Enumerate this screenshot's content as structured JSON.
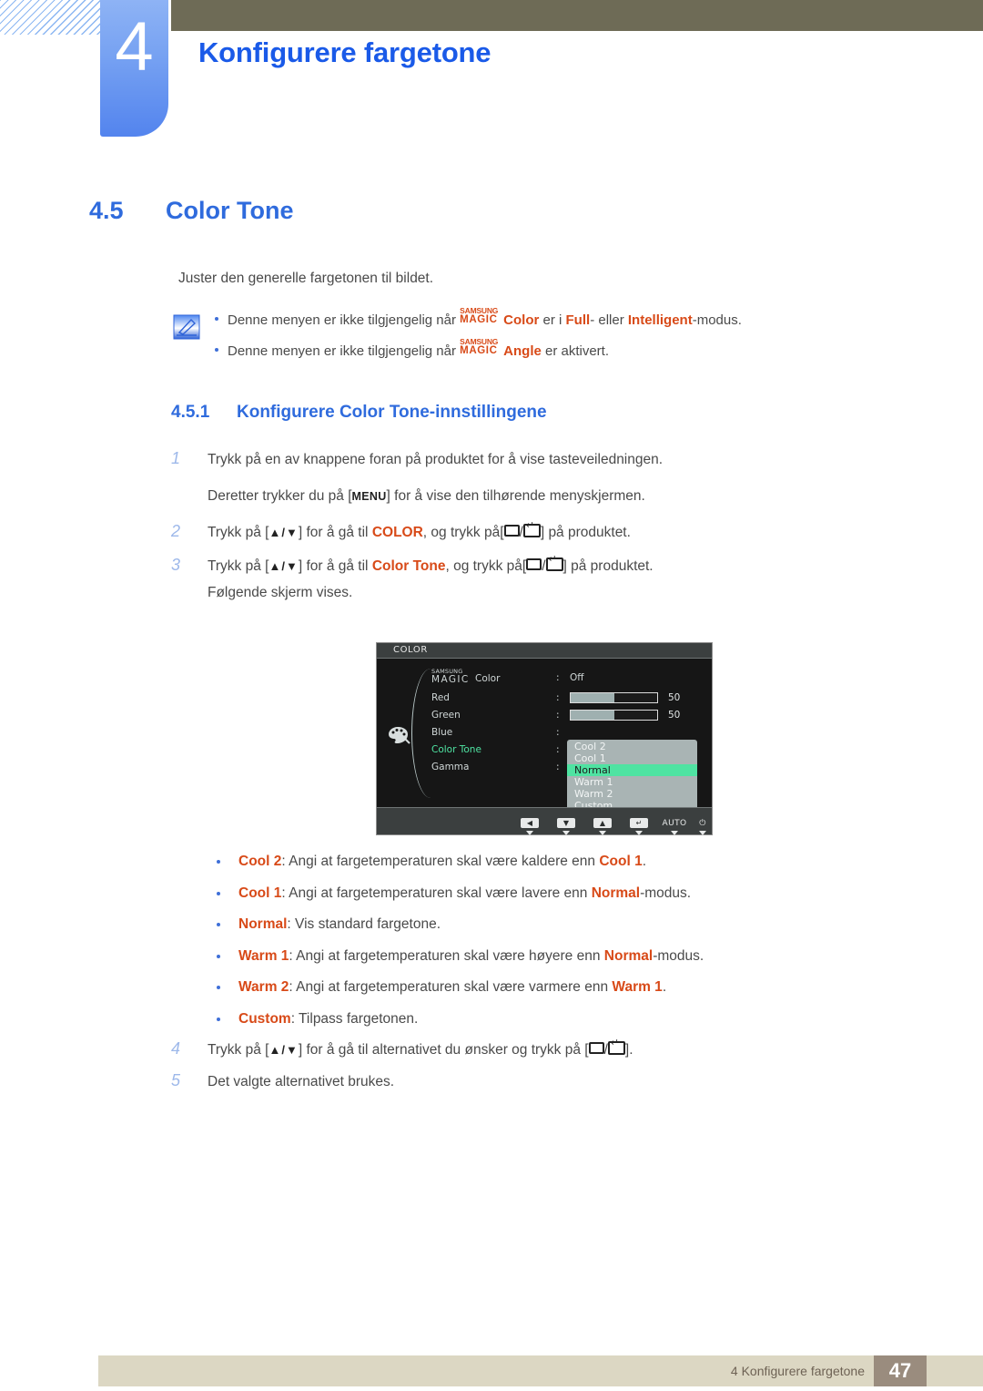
{
  "header": {
    "chapter_number": "4",
    "chapter_title": "Konfigurere fargetone"
  },
  "section": {
    "number": "4.5",
    "title": "Color Tone"
  },
  "intro": "Juster den generelle fargetonen til bildet.",
  "notes": {
    "icon": "note-pencil-icon",
    "items": [
      {
        "pre": "Denne menyen er ikke tilgjengelig når ",
        "magic_top": "SAMSUNG",
        "magic_bottom": "MAGIC",
        "magic_word": "Color",
        "mid": " er i ",
        "em1": "Full",
        "mid2": "- eller ",
        "em2": "Intelligent",
        "post": "-modus."
      },
      {
        "pre": "Denne menyen er ikke tilgjengelig når ",
        "magic_top": "SAMSUNG",
        "magic_bottom": "MAGIC",
        "magic_word": "Angle",
        "mid": " er aktivert.",
        "em1": "",
        "mid2": "",
        "em2": "",
        "post": ""
      }
    ]
  },
  "subsection": {
    "number": "4.5.1",
    "title": "Konfigurere Color Tone-innstillingene"
  },
  "steps": {
    "s1_num": "1",
    "s1_text": "Trykk på en av knappene foran på produktet for å vise tasteveiledningen.",
    "s1_sub_pre": "Deretter trykker du på [",
    "s1_sub_key": "MENU",
    "s1_sub_post": "] for å vise den tilhørende menyskjermen.",
    "s2_num": "2",
    "s2_a": "Trykk på [",
    "s2_arrows": "▲/▼",
    "s2_b": "] for å gå til ",
    "s2_target": "COLOR",
    "s2_c": ", og trykk på[",
    "s2_d": "/",
    "s2_e": "] på produktet.",
    "s3_num": "3",
    "s3_a": "Trykk på [",
    "s3_arrows": "▲/▼",
    "s3_b": "] for å gå til ",
    "s3_target": "Color Tone",
    "s3_c": ", og trykk på[",
    "s3_d": "/",
    "s3_e": "] på produktet.",
    "s3_sub": "Følgende skjerm vises.",
    "s4_num": "4",
    "s4_a": "Trykk på [",
    "s4_arrows": "▲/▼",
    "s4_b": "] for å gå til alternativet du ønsker og trykk på [",
    "s4_c": "/",
    "s4_d": "].",
    "s5_num": "5",
    "s5_text": "Det valgte alternativet brukes."
  },
  "osd": {
    "title": "COLOR",
    "icon": "palette-icon",
    "magic_top": "SAMSUNG",
    "magic_bottom": "MAGIC",
    "magic_word": "Color",
    "rows": [
      {
        "label": "Red",
        "colon": ":",
        "value": "50",
        "fill_percent": 50
      },
      {
        "label": "Green",
        "colon": ":",
        "value": "50",
        "fill_percent": 50
      },
      {
        "label": "Blue",
        "colon": ":",
        "value": ""
      },
      {
        "label": "Color Tone",
        "colon": ":",
        "value": ""
      },
      {
        "label": "Gamma",
        "colon": ":",
        "value": ""
      }
    ],
    "magic_value": "Off",
    "magic_colon": ":",
    "selected_label": "Color Tone",
    "dropdown": [
      {
        "label": "Cool 2",
        "selected": false
      },
      {
        "label": "Cool 1",
        "selected": false
      },
      {
        "label": "Normal",
        "selected": true
      },
      {
        "label": "Warm 1",
        "selected": false
      },
      {
        "label": "Warm 2",
        "selected": false
      },
      {
        "label": "Custom",
        "selected": false
      }
    ],
    "footer_buttons": [
      {
        "name": "left-button",
        "glyph": "◀",
        "type": "cap"
      },
      {
        "name": "down-button",
        "glyph": "▼",
        "type": "cap"
      },
      {
        "name": "up-button",
        "glyph": "▲",
        "type": "cap"
      },
      {
        "name": "enter-button",
        "glyph": "↵",
        "type": "cap"
      },
      {
        "name": "auto-button",
        "glyph": "AUTO",
        "type": "text"
      },
      {
        "name": "power-button",
        "glyph": "⏻",
        "type": "text"
      }
    ],
    "colors": {
      "highlight": "#4fe3a2",
      "dropdown_bg": "#a9b4b4",
      "panel_bg": "#161616",
      "bar_bg": "#3b3f3f"
    }
  },
  "options": [
    {
      "term": "Cool 2",
      "rest_a": ": Angi at fargetemperaturen skal være kaldere enn ",
      "ref": "Cool 1",
      "rest_b": "."
    },
    {
      "term": "Cool 1",
      "rest_a": ": Angi at fargetemperaturen skal være lavere enn ",
      "ref": "Normal",
      "rest_b": "-modus."
    },
    {
      "term": "Normal",
      "rest_a": ": Vis standard fargetone.",
      "ref": "",
      "rest_b": ""
    },
    {
      "term": "Warm 1",
      "rest_a": ": Angi at fargetemperaturen skal være høyere enn ",
      "ref": "Normal",
      "rest_b": "-modus."
    },
    {
      "term": "Warm 2",
      "rest_a": ": Angi at fargetemperaturen skal være varmere enn ",
      "ref": "Warm 1",
      "rest_b": "."
    },
    {
      "term": "Custom",
      "rest_a": ": Tilpass fargetonen.",
      "ref": "",
      "rest_b": ""
    }
  ],
  "footer": {
    "text": "4 Konfigurere fargetone",
    "page": "47"
  },
  "theme": {
    "accent_blue": "#2f6bdd",
    "title_blue": "#1a5ae8",
    "orange": "#d84a18",
    "header_bar": "#6e6b56",
    "footer_bg": "#dcd7c3",
    "page_box": "#9a8c7e"
  }
}
